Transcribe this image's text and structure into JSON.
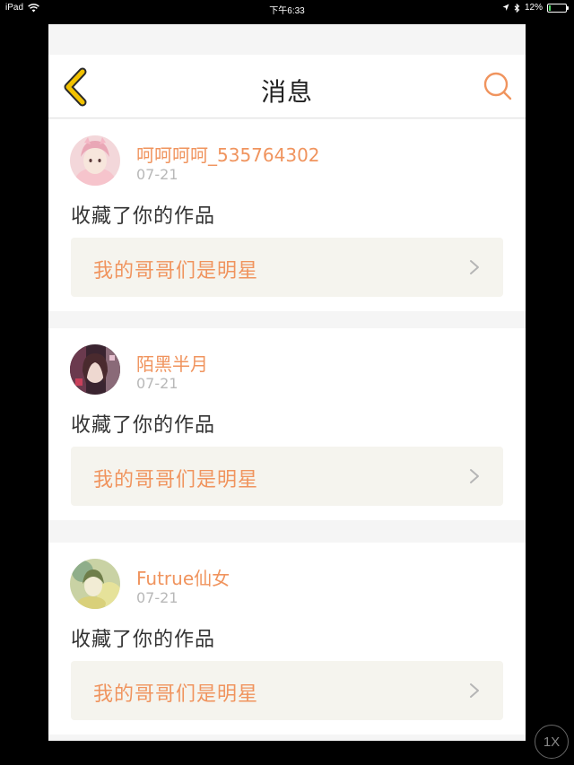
{
  "status_bar": {
    "device": "iPad",
    "time": "下午6:33",
    "battery_percent": "12%",
    "battery_level": 0.12
  },
  "header": {
    "title": "消息",
    "back_icon": "chevron-left-icon",
    "search_icon": "search-icon"
  },
  "messages": [
    {
      "username": "呵呵呵呵_535764302",
      "date": "07-21",
      "action": "收藏了你的作品",
      "work_title": "我的哥哥们是明星"
    },
    {
      "username": "陌黑半月",
      "date": "07-21",
      "action": "收藏了你的作品",
      "work_title": "我的哥哥们是明星"
    },
    {
      "username": "Futrue仙女",
      "date": "07-21",
      "action": "收藏了你的作品",
      "work_title": "我的哥哥们是明星"
    }
  ],
  "zoom_button": "1X",
  "colors": {
    "accent": "#f0945e",
    "back_icon": "#f2c200",
    "work_bg": "#f5f4ee"
  }
}
